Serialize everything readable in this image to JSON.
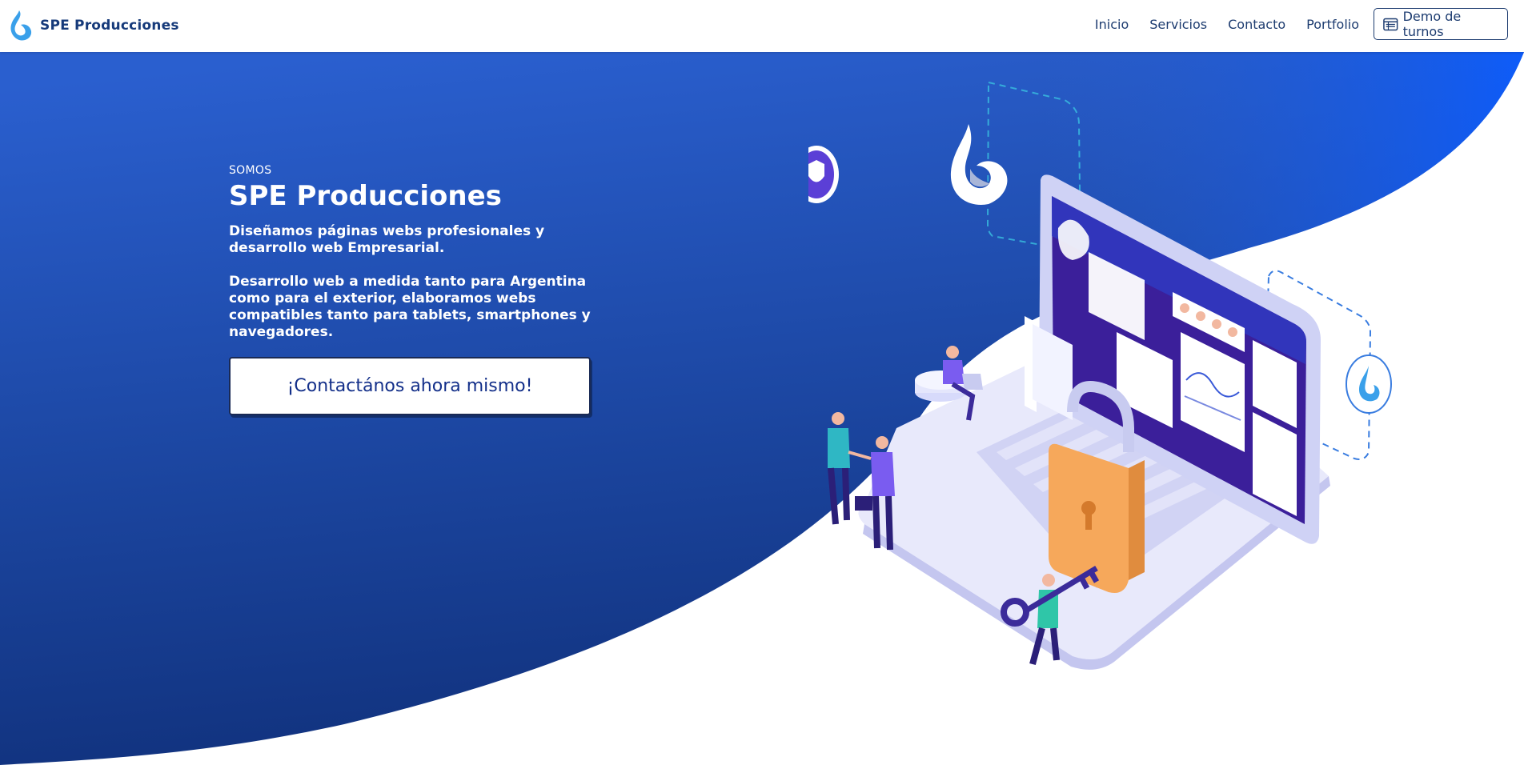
{
  "brand": {
    "name": "SPE Producciones",
    "logo_icon": "drop-logo-icon"
  },
  "nav": {
    "links": [
      "Inicio",
      "Servicios",
      "Contacto",
      "Portfolio"
    ],
    "demo_button": {
      "label": "Demo de turnos",
      "icon": "calendar-list-icon"
    }
  },
  "hero": {
    "eyebrow": "SOMOS",
    "title": "SPE Producciones",
    "paragraph1": "Diseñamos páginas webs profesionales y desarrollo web Empresarial.",
    "paragraph2": "Desarrollo web a medida tanto para Argentina como para el exterior, elaboramos webs compatibles tanto para tablets, smartphones y navegadores.",
    "cta_label": "¡Contactános ahora mismo!",
    "illustration": "laptop-security-teamwork-illustration"
  },
  "colors": {
    "brand_dark": "#163a7a",
    "hero_gradient_top": "#2a5fcf",
    "hero_gradient_bottom": "#10307a",
    "accent_blue": "#0b5cff",
    "lock_orange": "#f6a85b"
  }
}
